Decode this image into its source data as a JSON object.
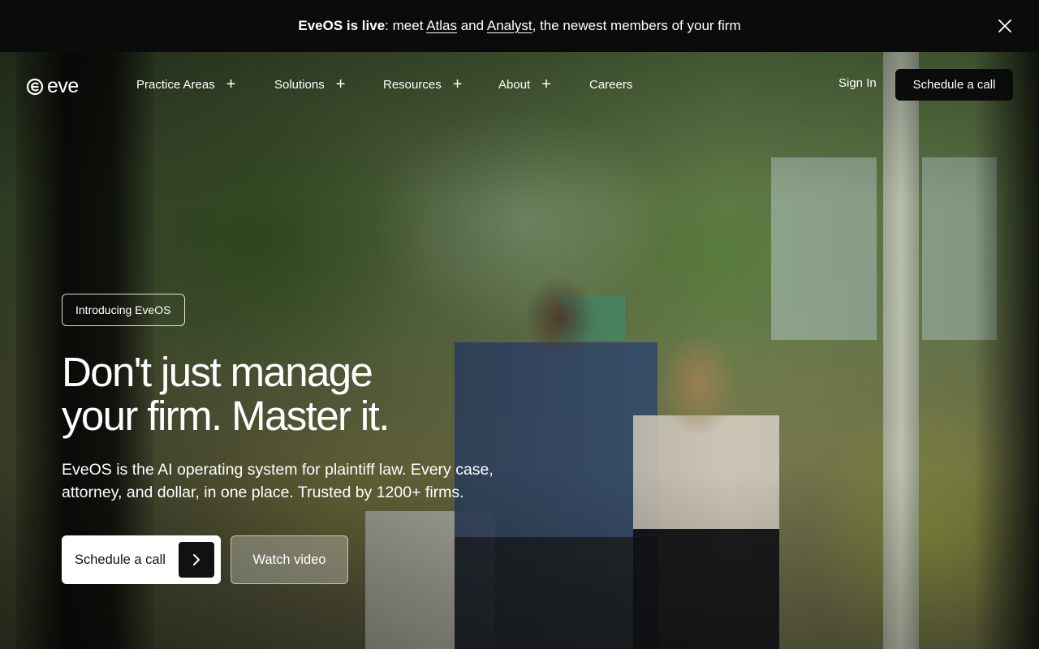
{
  "announcement": {
    "prefix": "EveOS is live",
    "middle": ": meet ",
    "link1": "Atlas",
    "and": " and ",
    "link2": "Analyst",
    "suffix": ", the newest members of your firm",
    "close_icon": "close-icon"
  },
  "nav": {
    "logo_text": "eve",
    "logo_icon": "eve-logo-icon",
    "items": [
      {
        "label": "Practice Areas",
        "has_submenu": true
      },
      {
        "label": "Solutions",
        "has_submenu": true
      },
      {
        "label": "Resources",
        "has_submenu": true
      },
      {
        "label": "About",
        "has_submenu": true
      },
      {
        "label": "Careers",
        "has_submenu": false
      }
    ],
    "plus_glyph": "+",
    "sign_in": "Sign In",
    "cta": "Schedule a call"
  },
  "hero": {
    "pill": "Introducing EveOS",
    "headline_line1": "Don't just manage",
    "headline_line2": "your firm. Master it.",
    "subtext_line1": "EveOS is the AI operating system for plaintiff law. Every case,",
    "subtext_line2": "attorney, and dollar, in one place. Trusted by 1200+ firms.",
    "primary_cta": "Schedule a call",
    "primary_cta_icon": "chevron-right-icon",
    "secondary_cta": "Watch video"
  },
  "colors": {
    "bar_bg": "#0b0b0b",
    "text_light": "#ffffff",
    "button_dark": "#111111"
  }
}
